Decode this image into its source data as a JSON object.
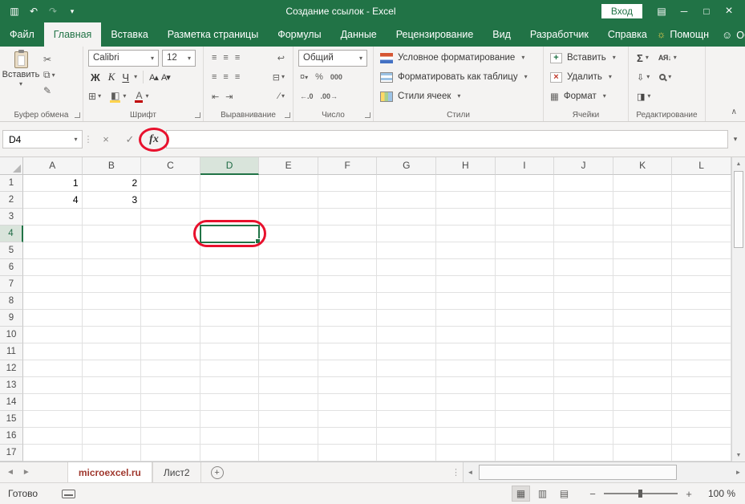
{
  "titlebar": {
    "title": "Создание ссылок  -  Excel",
    "signin": "Вход"
  },
  "tabs": {
    "items": [
      {
        "id": "file",
        "label": "Файл",
        "active": false
      },
      {
        "id": "home",
        "label": "Главная",
        "active": true
      },
      {
        "id": "insert",
        "label": "Вставка",
        "active": false
      },
      {
        "id": "page-layout",
        "label": "Разметка страницы",
        "active": false
      },
      {
        "id": "formulas",
        "label": "Формулы",
        "active": false
      },
      {
        "id": "data",
        "label": "Данные",
        "active": false
      },
      {
        "id": "review",
        "label": "Рецензирование",
        "active": false
      },
      {
        "id": "view",
        "label": "Вид",
        "active": false
      },
      {
        "id": "developer",
        "label": "Разработчик",
        "active": false
      },
      {
        "id": "help",
        "label": "Справка",
        "active": false
      }
    ],
    "assistant": "Помощн",
    "share": "Общий доступ"
  },
  "ribbon": {
    "clipboard": {
      "label": "Буфер обмена",
      "paste": "Вставить"
    },
    "font": {
      "label": "Шрифт",
      "family": "Calibri",
      "size": "12",
      "bold": "Ж",
      "italic": "К",
      "underline": "Ч"
    },
    "alignment": {
      "label": "Выравнивание"
    },
    "number": {
      "label": "Число",
      "format": "Общий"
    },
    "styles": {
      "label": "Стили",
      "conditional": "Условное форматирование",
      "format_table": "Форматировать как таблицу",
      "cell_styles": "Стили ячеек"
    },
    "cells": {
      "label": "Ячейки",
      "insert": "Вставить",
      "delete": "Удалить",
      "format": "Формат"
    },
    "editing": {
      "label": "Редактирование"
    }
  },
  "formula_bar": {
    "name_box": "D4",
    "fx": "fx"
  },
  "grid": {
    "columns": [
      "A",
      "B",
      "C",
      "D",
      "E",
      "F",
      "G",
      "H",
      "I",
      "J",
      "K",
      "L"
    ],
    "row_count": 17,
    "cells": {
      "A1": "1",
      "B1": "2",
      "A2": "4",
      "B2": "3"
    },
    "selection": {
      "cell": "D4",
      "column": "D",
      "row": 4
    }
  },
  "sheets": {
    "tabs": [
      {
        "label": "microexcel.ru",
        "active": true
      },
      {
        "label": "Лист2",
        "active": false
      }
    ]
  },
  "status": {
    "ready": "Готово",
    "zoom": "100 %"
  },
  "icons": {
    "save": "▥",
    "undo": "↶",
    "redo": "↷",
    "qat_more": "▾",
    "ribbon_display": "▤",
    "minimize": "─",
    "maximize": "□",
    "close": "×",
    "bulb": "☼",
    "person": "☺",
    "cut": "✂",
    "copy": "⧉",
    "format_painter": "✎",
    "dropdown": "▾",
    "font_larger": "А▴",
    "font_smaller": "А▾",
    "borders": "⊞",
    "fill_color": "◧",
    "font_color": "А",
    "align_lines": "≡",
    "wrap_text": "↩",
    "merge_center": "⊟",
    "indent_dec": "⇤",
    "indent_inc": "⇥",
    "orientation": "∕",
    "currency": "¤",
    "percent": "%",
    "thousands": "000",
    "inc_decimal": "←.0",
    "dec_decimal": ".00→",
    "sum": "Σ",
    "fill_down": "⇩",
    "clear": "◨",
    "sort": "АЯ↓",
    "format_cells_icon": "▦",
    "insert_cells_icon": "+",
    "delete_cells_icon": "×",
    "check": "✓",
    "cancel": "×",
    "dots": "⋮",
    "up": "▲",
    "down": "▼",
    "left": "◄",
    "right": "►",
    "view_normal": "▦",
    "view_layout": "▥",
    "view_break": "▤",
    "zoom_out": "−",
    "zoom_in": "+",
    "add_sheet": "+",
    "collapse": "∧"
  }
}
